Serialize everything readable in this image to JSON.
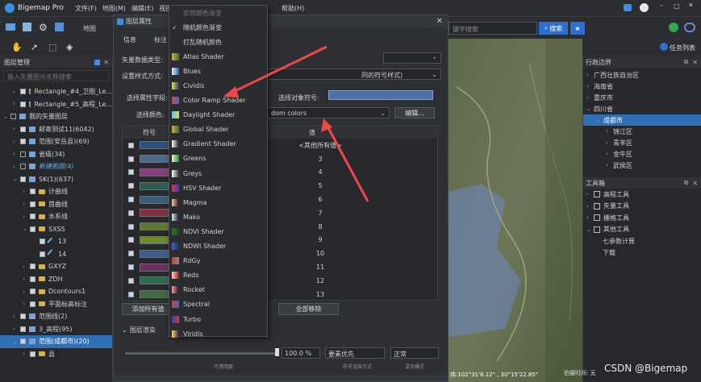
{
  "app": {
    "name": "Bigemap Pro",
    "menus": [
      "文件(F)",
      "地图(M)",
      "编辑(E)",
      "视图(V)",
      "帮助(H)"
    ]
  },
  "toolbar": {
    "map_label": "地图",
    "search_placeholder": "键字搜索",
    "search_btn": "搜索",
    "measure": "测量",
    "task_list": "任务列表",
    "accent": "#2d6fd0"
  },
  "left_panel": {
    "title": "图层管理",
    "search_placeholder": "输入矢量图元名称搜索",
    "items": [
      {
        "label": "Rectangle_#4_卫图_Le...",
        "indent": 1,
        "checked": true,
        "arrow": "›",
        "icon": "img"
      },
      {
        "label": "Rectangle_#5_高程_Le...",
        "indent": 1,
        "checked": true,
        "arrow": "›",
        "icon": "img"
      },
      {
        "label": "我的矢量图层",
        "indent": 0,
        "checked": false,
        "arrow": "⌄",
        "icon": "layer"
      },
      {
        "label": "邮寄测试11(6042)",
        "indent": 1,
        "checked": true,
        "arrow": "›",
        "icon": "layer"
      },
      {
        "label": "范围(安岳县)(69)",
        "indent": 1,
        "checked": true,
        "arrow": "›",
        "icon": "layer"
      },
      {
        "label": "省级(34)",
        "indent": 1,
        "checked": false,
        "arrow": "›",
        "icon": "layer"
      },
      {
        "label": "新建图层(4)",
        "indent": 1,
        "checked": false,
        "arrow": "›",
        "icon": "layer",
        "italic": true
      },
      {
        "label": "SK(1)(637)",
        "indent": 1,
        "checked": true,
        "arrow": "⌄",
        "icon": "layer"
      },
      {
        "label": "计曲线",
        "indent": 2,
        "checked": true,
        "arrow": "›",
        "icon": "folder"
      },
      {
        "label": "首曲线",
        "indent": 2,
        "checked": true,
        "arrow": "›",
        "icon": "folder"
      },
      {
        "label": "水系线",
        "indent": 2,
        "checked": true,
        "arrow": "›",
        "icon": "folder"
      },
      {
        "label": "SXSS",
        "indent": 2,
        "checked": true,
        "arrow": "⌄",
        "icon": "folder"
      },
      {
        "label": "13",
        "indent": 3,
        "checked": true,
        "arrow": "",
        "icon": "line"
      },
      {
        "label": "14",
        "indent": 3,
        "checked": true,
        "arrow": "",
        "icon": "line"
      },
      {
        "label": "GXYZ",
        "indent": 2,
        "checked": true,
        "arrow": "›",
        "icon": "folder"
      },
      {
        "label": "ZDH",
        "indent": 2,
        "checked": true,
        "arrow": "›",
        "icon": "folder"
      },
      {
        "label": "Dcontours1",
        "indent": 2,
        "checked": true,
        "arrow": "›",
        "icon": "folder"
      },
      {
        "label": "平面标高标注",
        "indent": 2,
        "checked": true,
        "arrow": "›",
        "icon": "folder"
      },
      {
        "label": "范围线(2)",
        "indent": 1,
        "checked": true,
        "arrow": "›",
        "icon": "layer"
      },
      {
        "label": "3_高程(95)",
        "indent": 1,
        "checked": true,
        "arrow": "›",
        "icon": "layer"
      },
      {
        "label": "范围(成都市)(20)",
        "indent": 1,
        "checked": true,
        "arrow": "⌄",
        "icon": "layer",
        "selected": true
      },
      {
        "label": "县",
        "indent": 2,
        "checked": true,
        "arrow": "›",
        "icon": "folder"
      }
    ]
  },
  "dialog": {
    "title": "图层属性",
    "tabs": [
      "信息",
      "标注"
    ],
    "label_data_type": "矢量数据类型:",
    "label_style": "设置样式方式:",
    "label_field": "选择属性字段:",
    "label_color": "选择颜色:",
    "style_value_suffix": "同的符号样式)",
    "field_symbol_label": "选择对象符号:",
    "color_value": "dom colors",
    "edit_btn": "编辑...",
    "col_symbol": "符号",
    "col_value": "值",
    "rows": [
      {
        "color": "#2d4f7a",
        "value": "<其他所有值>"
      },
      {
        "color": "#4b6b86",
        "value": "3"
      },
      {
        "color": "#8a3d7a",
        "value": "4"
      },
      {
        "color": "#2f5a52",
        "value": "5"
      },
      {
        "color": "#3a5f7a",
        "value": "6"
      },
      {
        "color": "#8a2e44",
        "value": "7"
      },
      {
        "color": "#5e7a30",
        "value": "8"
      },
      {
        "color": "#6f8a2a",
        "value": "9"
      },
      {
        "color": "#3e5e8a",
        "value": "10"
      },
      {
        "color": "#6a2f5e",
        "value": "11"
      },
      {
        "color": "#2f6b4e",
        "value": "12"
      },
      {
        "color": "#3f6a3a",
        "value": "13"
      }
    ],
    "add_all_btn": "添加所有值",
    "remove_all_btn": "全部移除",
    "render_label": "图层渲染",
    "opacity": "100.0 %",
    "opacity_label": "不透明度",
    "symbol_order": "要素优先",
    "symbol_order_label": "符号渲染方式",
    "blend": "正常",
    "blend_label": "混合模式"
  },
  "dropdown": {
    "items": [
      {
        "label": "反转颜色渐变",
        "kind": "disabled"
      },
      {
        "label": "随机颜色渐变",
        "kind": "check"
      },
      {
        "label": "打乱随机颜色",
        "kind": "text"
      },
      {
        "label": "Atlas Shader",
        "kind": "color",
        "c1": "#d4b23c",
        "c2": "#3a6b3a"
      },
      {
        "label": "Blues",
        "kind": "color",
        "c1": "#e8f0fa",
        "c2": "#2b5fa8"
      },
      {
        "label": "Cividis",
        "kind": "color",
        "c1": "#f4e04a",
        "c2": "#2a3c6a"
      },
      {
        "label": "Color Ramp Shader",
        "kind": "color",
        "c1": "#d44",
        "c2": "#3a6fd0"
      },
      {
        "label": "Daylight Shader",
        "kind": "color",
        "c1": "#4ad0f0",
        "c2": "#f0d04a"
      },
      {
        "label": "Global Shader",
        "kind": "color",
        "c1": "#d4b23c",
        "c2": "#3a6b3a"
      },
      {
        "label": "Gradient Shader",
        "kind": "color",
        "c1": "#ffffff",
        "c2": "#222222"
      },
      {
        "label": "Greens",
        "kind": "color",
        "c1": "#e6f5e0",
        "c2": "#2e8a3a"
      },
      {
        "label": "Greys",
        "kind": "color",
        "c1": "#ffffff",
        "c2": "#333333"
      },
      {
        "label": "HSV Shader",
        "kind": "color",
        "c1": "#e33",
        "c2": "#33e"
      },
      {
        "label": "Magma",
        "kind": "color",
        "c1": "#fcd08a",
        "c2": "#2a0a3a"
      },
      {
        "label": "Mako",
        "kind": "color",
        "c1": "#cdeedc",
        "c2": "#1a1a3a"
      },
      {
        "label": "NDVI Shader",
        "kind": "color",
        "c1": "#2a7a2a",
        "c2": "#1a4a1a"
      },
      {
        "label": "NDWI Shader",
        "kind": "color",
        "c1": "#3a6aca",
        "c2": "#1a2a6a"
      },
      {
        "label": "RdGy",
        "kind": "color",
        "c1": "#d43a3a",
        "c2": "#888888"
      },
      {
        "label": "Reds",
        "kind": "color",
        "c1": "#fbd0c0",
        "c2": "#b01a1a"
      },
      {
        "label": "Rocket",
        "kind": "color",
        "c1": "#f0a080",
        "c2": "#3a0a2a"
      },
      {
        "label": "Spectral",
        "kind": "color",
        "c1": "#d43a3a",
        "c2": "#3a6aca"
      },
      {
        "label": "Turbo",
        "kind": "color",
        "c1": "#3a3aca",
        "c2": "#ca3a3a"
      },
      {
        "label": "Viridis",
        "kind": "color",
        "c1": "#f4e04a",
        "c2": "#3a1a5a"
      }
    ]
  },
  "right_panel": {
    "admin_title": "行政边界",
    "admin_items": [
      {
        "label": "广西壮族自治区",
        "indent": 0,
        "arrow": "›"
      },
      {
        "label": "海南省",
        "indent": 0,
        "arrow": "›"
      },
      {
        "label": "重庆市",
        "indent": 0,
        "arrow": "›"
      },
      {
        "label": "四川省",
        "indent": 0,
        "arrow": "⌄"
      },
      {
        "label": "成都市",
        "indent": 1,
        "arrow": "⌄",
        "selected": true
      },
      {
        "label": "锦江区",
        "indent": 2,
        "arrow": "›"
      },
      {
        "label": "青羊区",
        "indent": 2,
        "arrow": "›"
      },
      {
        "label": "金牛区",
        "indent": 2,
        "arrow": "›"
      },
      {
        "label": "武侯区",
        "indent": 2,
        "arrow": "›"
      }
    ],
    "toolbox_title": "工具箱",
    "toolbox_items": [
      {
        "label": "高程工具",
        "arrow": "›"
      },
      {
        "label": "矢量工具",
        "arrow": "›"
      },
      {
        "label": "栅格工具",
        "arrow": "›"
      },
      {
        "label": "其他工具",
        "arrow": "⌄"
      }
    ],
    "tool_sub": [
      "七参数计算",
      "下载"
    ]
  },
  "status": {
    "coords": "纬:102°31'8.12\" , 30°15'22.85\"",
    "zoom": "拍摄时间: 无"
  },
  "watermark": "CSDN @Bigemap"
}
